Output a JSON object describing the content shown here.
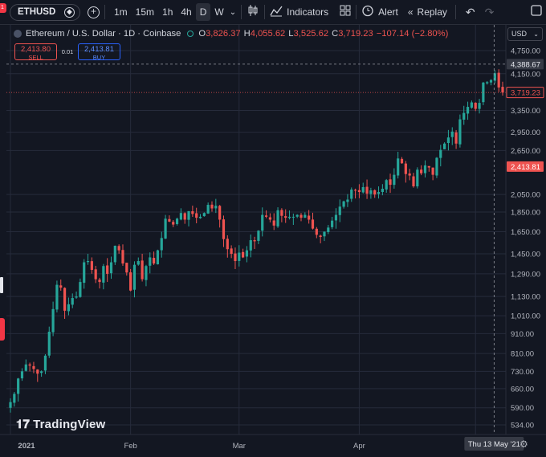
{
  "toolbar": {
    "symbol": "ETHUSD",
    "intervals": [
      "1m",
      "15m",
      "1h",
      "4h",
      "D",
      "W"
    ],
    "active_interval": "D",
    "indicators_label": "Indicators",
    "alert_label": "Alert",
    "replay_label": "Replay",
    "icons": [
      "plus-icon",
      "chevron-down-icon",
      "candles-icon",
      "indicators-icon",
      "templates-icon",
      "alert-clock-icon",
      "replay-icon",
      "undo-icon",
      "redo-icon",
      "fullscreen-icon"
    ]
  },
  "legend": {
    "title": "Ethereum / U.S. Dollar · 1D · Coinbase",
    "o_label": "O",
    "o": "3,826.37",
    "h_label": "H",
    "h": "4,055.62",
    "l_label": "L",
    "l": "3,525.62",
    "c_label": "C",
    "c": "3,719.23",
    "change": "−107.14 (−2.80%)"
  },
  "trade": {
    "sell_price": "2,413.80",
    "sell_label": "SELL",
    "spread": "0.01",
    "buy_price": "2,413.81",
    "buy_label": "BUY"
  },
  "currency": "USD",
  "branding": "TradingView",
  "badges": {
    "notification": "1"
  },
  "colors": {
    "up": "#26a69a",
    "down": "#ef5350",
    "background": "#131722",
    "grid": "#262b3b"
  },
  "chart_data": {
    "type": "candlestick",
    "symbol": "ETHUSD",
    "y_ticks": [
      4750,
      4150,
      3350,
      2950,
      2650,
      2050,
      1850,
      1650,
      1450,
      1290,
      1130,
      1010,
      910,
      810,
      730,
      660,
      590,
      534
    ],
    "y_tick_labels": [
      "4,750.00",
      "4,150.00",
      "3,350.00",
      "2,950.00",
      "2,650.00",
      "2,050.00",
      "1,850.00",
      "1,650.00",
      "1,450.00",
      "1,290.00",
      "1,130.00",
      "1,010.00",
      "910.00",
      "810.00",
      "730.00",
      "660.00",
      "590.00",
      "534.00"
    ],
    "y_scale": "log",
    "x_labels": [
      "2021",
      "Feb",
      "Mar",
      "Apr"
    ],
    "crosshair_date": "Thu 13 May '21",
    "crosshair_price": "4,388.67",
    "last_price": "3,719.23",
    "bid_line_price": "2,413.81",
    "closes": [
      610,
      640,
      700,
      730,
      760,
      755,
      740,
      720,
      730,
      800,
      920,
      1050,
      1210,
      1190,
      1040,
      1080,
      1120,
      1130,
      1230,
      1380,
      1390,
      1320,
      1250,
      1230,
      1350,
      1290,
      1380,
      1520,
      1480,
      1370,
      1300,
      1170,
      1360,
      1390,
      1250,
      1350,
      1420,
      1370,
      1480,
      1590,
      1780,
      1750,
      1720,
      1780,
      1840,
      1770,
      1860,
      1830,
      1790,
      1800,
      1840,
      1930,
      1890,
      1920,
      1770,
      1580,
      1490,
      1450,
      1390,
      1460,
      1420,
      1480,
      1570,
      1560,
      1660,
      1820,
      1800,
      1770,
      1710,
      1870,
      1810,
      1790,
      1800,
      1800,
      1820,
      1790,
      1820,
      1770,
      1680,
      1620,
      1600,
      1650,
      1690,
      1760,
      1820,
      1910,
      1970,
      1990,
      2110,
      2100,
      2080,
      2140,
      2060,
      2100,
      2050,
      2080,
      2120,
      2230,
      2170,
      2300,
      2530,
      2460,
      2310,
      2290,
      2150,
      2370,
      2320,
      2430,
      2400,
      2300,
      2540,
      2660,
      2760,
      2860,
      2960,
      2760,
      3180,
      3300,
      3420,
      3510,
      3380,
      3500,
      3940,
      3950,
      4000,
      4160,
      3830,
      3719
    ]
  }
}
